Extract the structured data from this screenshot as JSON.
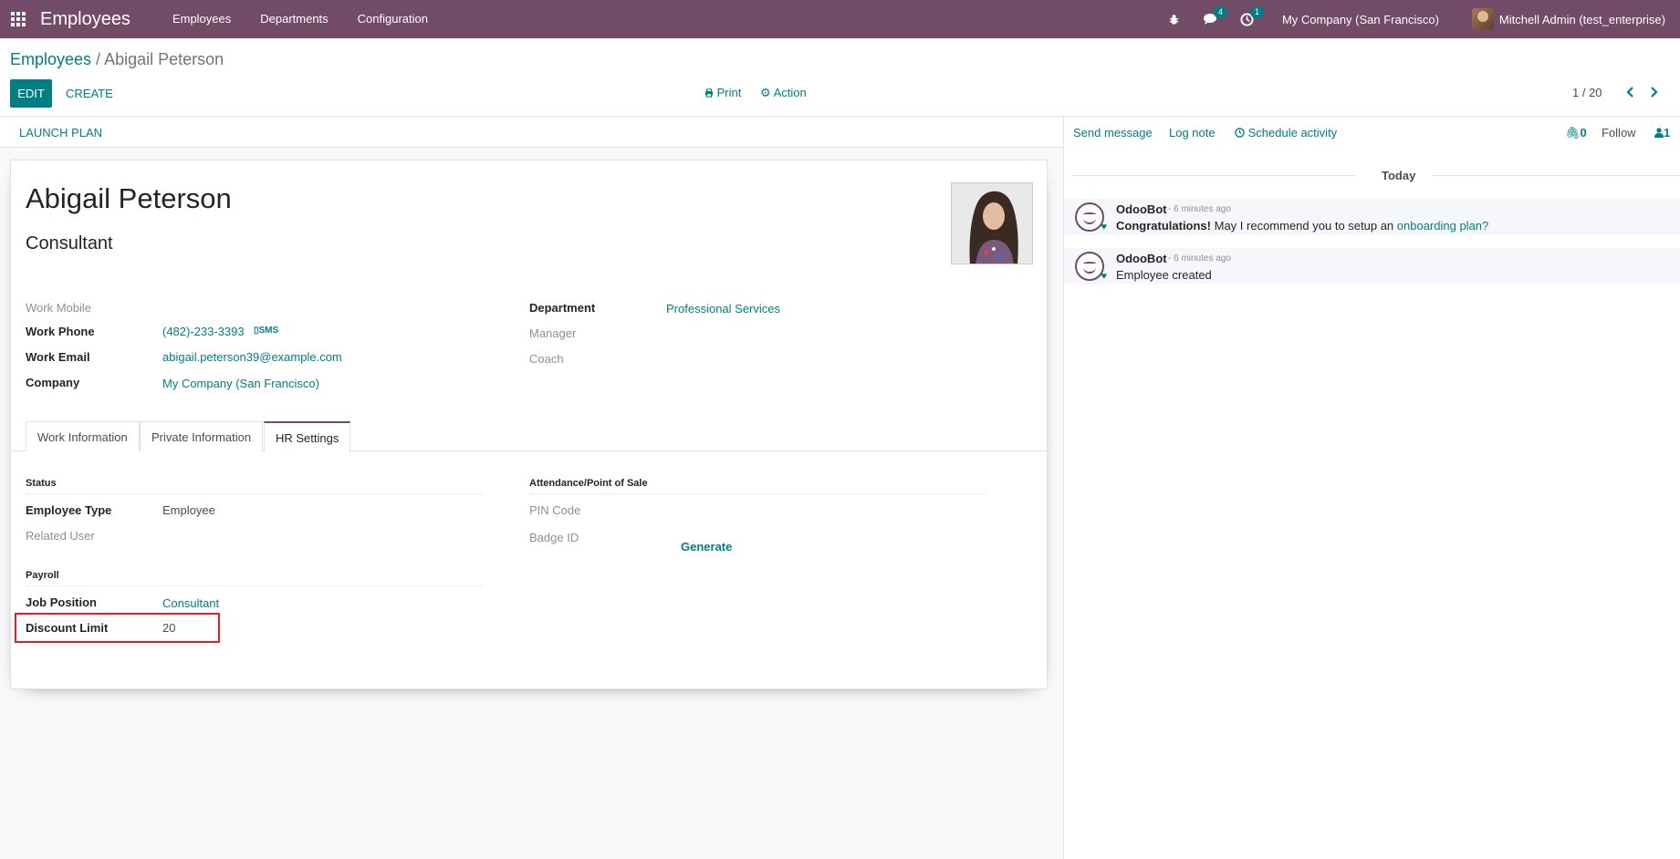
{
  "navbar": {
    "app_title": "Employees",
    "menu": [
      "Employees",
      "Departments",
      "Configuration"
    ],
    "messages_count": "4",
    "activities_count": "1",
    "company": "My Company (San Francisco)",
    "user": "Mitchell Admin (test_enterprise)"
  },
  "breadcrumb": {
    "parent": "Employees",
    "separator": " / ",
    "current": "Abigail Peterson"
  },
  "toolbar": {
    "edit": "EDIT",
    "create": "CREATE",
    "print": "Print",
    "action": "Action"
  },
  "pager": {
    "value": "1 / 20"
  },
  "statusbar": {
    "launch_plan": "LAUNCH PLAN"
  },
  "employee": {
    "name": "Abigail Peterson",
    "job_title": "Consultant",
    "fields_left": [
      {
        "label": "Work Mobile",
        "value": ""
      },
      {
        "label": "Work Phone",
        "value": "(482)-233-3393",
        "sms": "SMS"
      },
      {
        "label": "Work Email",
        "value": "abigail.peterson39@example.com"
      },
      {
        "label": "Company",
        "value": "My Company (San Francisco)"
      }
    ],
    "fields_right": [
      {
        "label": "Department",
        "value": "Professional Services"
      },
      {
        "label": "Manager",
        "value": ""
      },
      {
        "label": "Coach",
        "value": ""
      }
    ]
  },
  "tabs": [
    "Work Information",
    "Private Information",
    "HR Settings"
  ],
  "hr_settings": {
    "status_title": "Status",
    "employee_type_label": "Employee Type",
    "employee_type_value": "Employee",
    "related_user_label": "Related User",
    "payroll_title": "Payroll",
    "job_position_label": "Job Position",
    "job_position_value": "Consultant",
    "discount_limit_label": "Discount Limit",
    "discount_limit_value": "20",
    "attendance_title": "Attendance/Point of Sale",
    "pin_code_label": "PIN Code",
    "badge_id_label": "Badge ID",
    "generate_label": "Generate"
  },
  "chatter": {
    "send_message": "Send message",
    "log_note": "Log note",
    "schedule_activity": "Schedule activity",
    "attachments_count": "0",
    "follow": "Follow",
    "followers_count": "1",
    "today": "Today",
    "messages": [
      {
        "author": "OdooBot",
        "time": "- 6 minutes ago",
        "bold": "Congratulations!",
        "text": " May I recommend you to setup an ",
        "link": "onboarding plan?"
      },
      {
        "author": "OdooBot",
        "time": "- 6 minutes ago",
        "text": "Employee created"
      }
    ]
  },
  "colors": {
    "brand": "#714b67",
    "accent": "#017e84",
    "highlight": "#e02020"
  }
}
